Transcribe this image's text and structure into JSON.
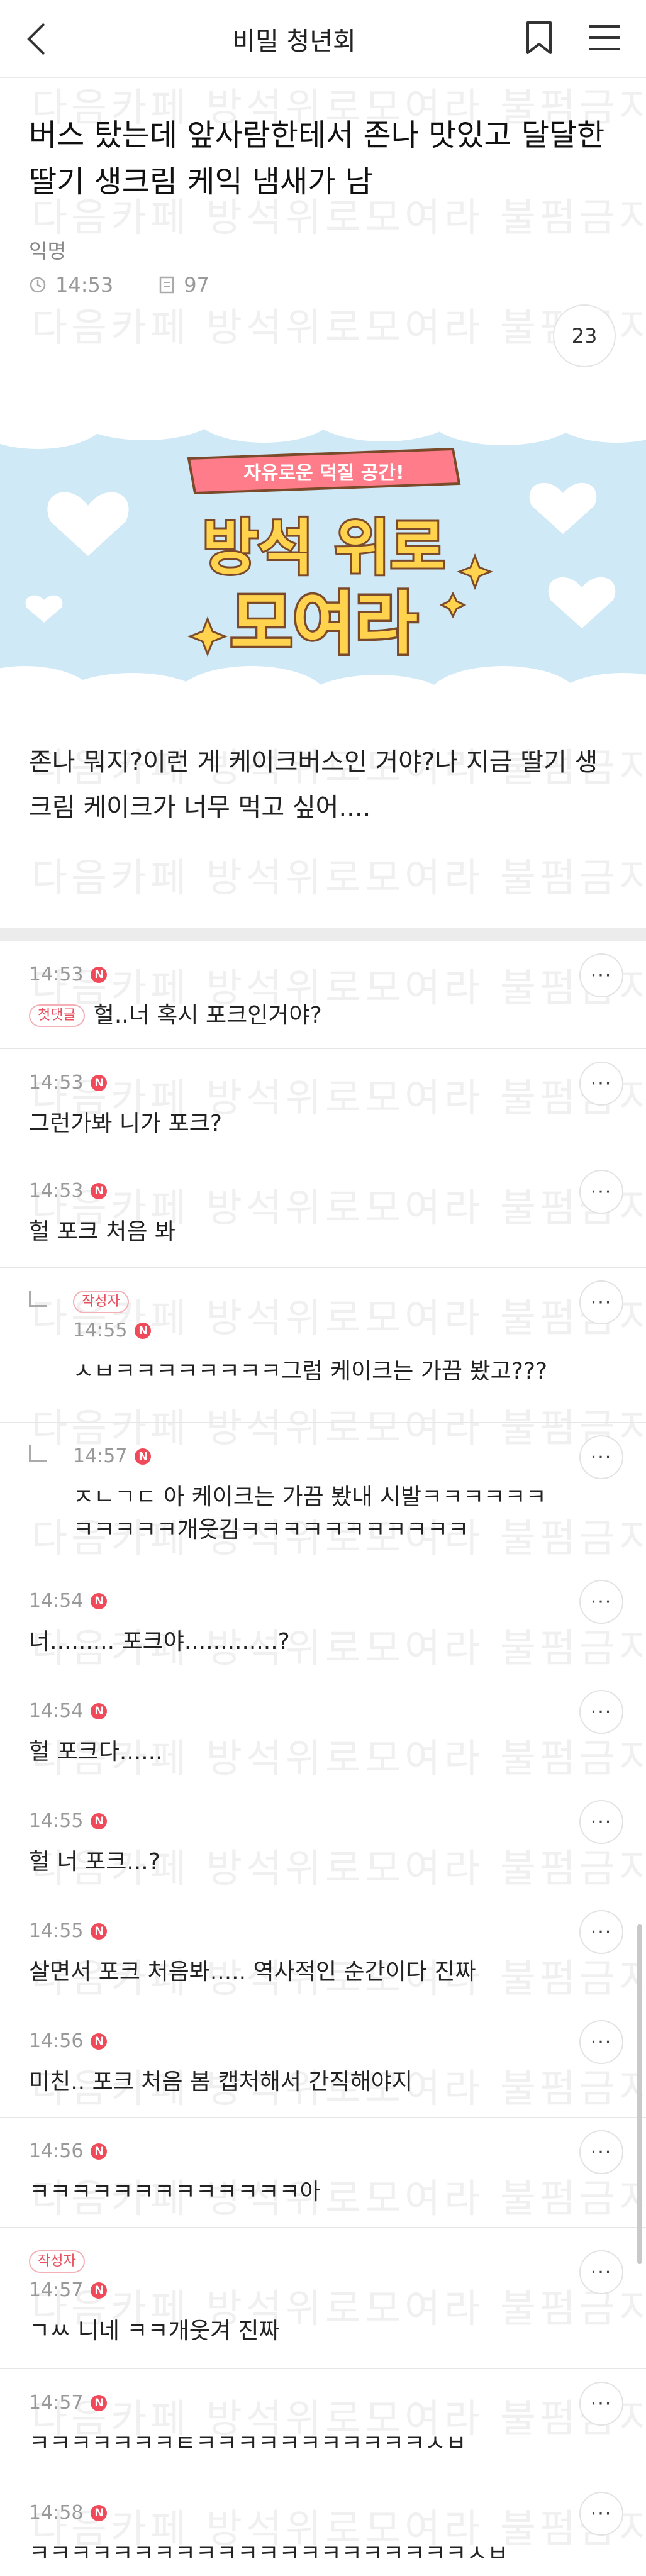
{
  "header": {
    "title": "비밀 청년회"
  },
  "post": {
    "title": "버스 탔는데 앞사람한테서 존나 맛있고 달달한 딸기 생크림 케익 냄새가 남",
    "author": "익명",
    "time": "14:53",
    "views": "97",
    "comment_count": "23",
    "body": "존나 뭐지?이런 게 케이크버스인 거야?나 지금 딸기 생크림 케이크가 너무 먹고 싶어...."
  },
  "banner": {
    "ribbon_text": "자유로운 덕질 공간!",
    "line1": "방석 위로",
    "line2": "모여라"
  },
  "watermark": {
    "text": "다음카페 방석위로모여라 불펌금지"
  },
  "badges": {
    "first_comment": "첫댓글",
    "author": "작성자",
    "new": "N"
  },
  "more_label": "···",
  "comments": [
    {
      "time": "14:53",
      "text": "헐..너 혹시 포크인거야?"
    },
    {
      "time": "14:53",
      "text": "그런가봐 니가 포크?"
    },
    {
      "time": "14:53",
      "text": "헐 포크 처음 봐"
    },
    {
      "time": "14:55",
      "text": "ㅅㅂㅋㅋㅋㅋㅋㅋㅋㅋ그럼 케이크는 가끔 봤고???"
    },
    {
      "time": "14:57",
      "text": "ㅈㄴㄱㄷ 아 케이크는 가끔 봤내 시발ㅋㅋㅋㅋㅋㅋㅋㅋㅋㅋㅋ개웃김ㅋㅋㅋㅋㅋㅋㅋㅋㅋㅋㅋ"
    },
    {
      "time": "14:54",
      "text": "너......... 포크야.............?"
    },
    {
      "time": "14:54",
      "text": "헐 포크다......"
    },
    {
      "time": "14:55",
      "text": "헐 너 포크...?"
    },
    {
      "time": "14:55",
      "text": "살면서 포크 처음봐..... 역사적인 순간이다 진짜"
    },
    {
      "time": "14:56",
      "text": "미친.. 포크 처음 봄 캡처해서 간직해야지"
    },
    {
      "time": "14:56",
      "text": "ㅋㅋㅋㅋㅋㅋㅋㅋㅋㅋㅋㅋㅋ아"
    },
    {
      "time": "14:57",
      "text": "ㄱㅆ 니네 ㅋㅋ개웃겨 진짜"
    },
    {
      "time": "14:57",
      "text": "ㅋㅋㅋㅋㅋㅋㅋㅌㅋㅋㅋㅋㅋㅋㅋㅋㅋㅋㅋㅅㅂ"
    },
    {
      "time": "14:58",
      "text": "ㅋㅋㅋㅋㅋㅋㅋㅋㅋㅋㅋㅋㅋㅋㅋㅋㅋㅋㅋㅋㅋㅅㅂ"
    }
  ],
  "colors": {
    "new_dot": "#f04a5a",
    "banner_sky": "#cfe9f7",
    "banner_title": "#7b4a2a",
    "ribbon": "#ff7c8a"
  }
}
